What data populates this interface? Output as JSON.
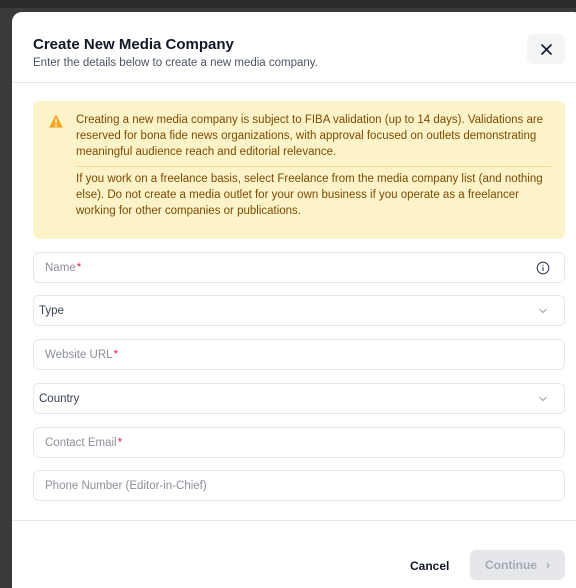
{
  "dialog": {
    "title": "Create New Media Company",
    "subtitle": "Enter the details below to create a new media company.",
    "close_icon": "close-icon"
  },
  "alert": {
    "icon": "warning-triangle-icon",
    "color": "#f5a524",
    "paragraph1": "Creating a new media company is subject to FIBA validation (up to 14 days). Validations are reserved for bona fide news organizations, with approval focused on outlets demonstrating meaningful audience reach and editorial relevance.",
    "paragraph2": "If you work on a freelance basis, select Freelance from the media company list (and nothing else). Do not create a media outlet for your own business if you operate as a freelancer working for other companies or publications."
  },
  "form": {
    "name": {
      "placeholder": "Name",
      "required_mark": "*"
    },
    "type": {
      "placeholder": "Type"
    },
    "website": {
      "placeholder": "Website URL",
      "required_mark": "*"
    },
    "country": {
      "placeholder": "Country"
    },
    "email": {
      "placeholder": "Contact Email",
      "required_mark": "*"
    },
    "phone": {
      "placeholder": "Phone Number (Editor-in-Chief)"
    }
  },
  "footer": {
    "cancel_label": "Cancel",
    "continue_label": "Continue",
    "continue_chevron": "›"
  }
}
